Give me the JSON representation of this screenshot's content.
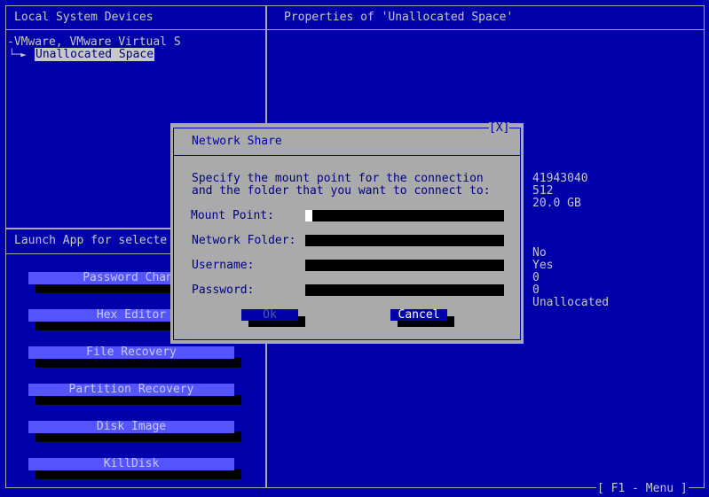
{
  "left_panel": {
    "title": "Local System Devices",
    "tree": {
      "root": "-VMware, VMware Virtual S",
      "child_branch": "└─►",
      "child_label": "Unallocated Space"
    }
  },
  "right_panel": {
    "title": "Properties of 'Unallocated Space'",
    "values": [
      "41943040",
      "512",
      "20.0 GB",
      "No",
      "Yes",
      "0",
      "0",
      "Unallocated"
    ]
  },
  "launch_panel": {
    "title": "Launch App for selecte",
    "buttons": [
      "Password Chang",
      "Hex Editor",
      "File Recovery",
      "Partition Recovery",
      "Disk Image",
      "KillDisk"
    ]
  },
  "status_bar": {
    "menu_hint": "[ F1 - Menu ]"
  },
  "dialog": {
    "title": "Network Share",
    "close_label": "[X]",
    "instructions_line1": "Specify the mount point for the connection",
    "instructions_line2": "and the folder that you want to connect to:",
    "fields": {
      "mount_point": {
        "label": "Mount Point:",
        "value": ""
      },
      "network_folder": {
        "label": "Network Folder:",
        "value": ""
      },
      "username": {
        "label": "Username:",
        "value": ""
      },
      "password": {
        "label": "Password:",
        "value": ""
      }
    },
    "ok_label": "Ok",
    "cancel_label": "Cancel"
  },
  "colors": {
    "background": "#0000aa",
    "frame": "#aaaaaa",
    "button": "#5555ff",
    "dialog_bg": "#aaaaaa",
    "selected_button": "#0000aa"
  }
}
